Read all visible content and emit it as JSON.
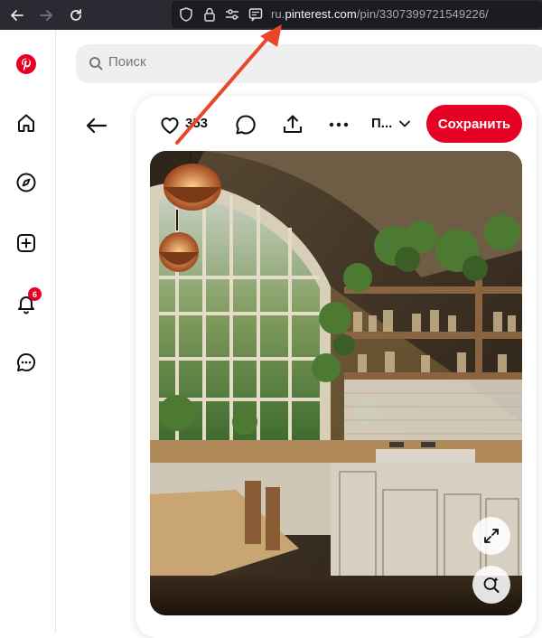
{
  "browser": {
    "url_prefix": "ru.",
    "url_domain": "pinterest.com",
    "url_path": "/pin/3307399721549226/"
  },
  "sidebar": {
    "items": [
      {
        "name": "pinterest-logo-icon"
      },
      {
        "name": "home-icon"
      },
      {
        "name": "explore-compass-icon"
      },
      {
        "name": "create-plus-icon"
      },
      {
        "name": "notifications-bell-icon",
        "badge": "6"
      },
      {
        "name": "messages-icon"
      }
    ]
  },
  "search": {
    "placeholder": "Поиск"
  },
  "pin": {
    "like_count": "353",
    "board_name": "П...",
    "save_label": "Сохранить"
  },
  "colors": {
    "accent": "#e60023",
    "annotation_arrow": "#e8472b",
    "browser_chrome": "#2b2a33"
  }
}
